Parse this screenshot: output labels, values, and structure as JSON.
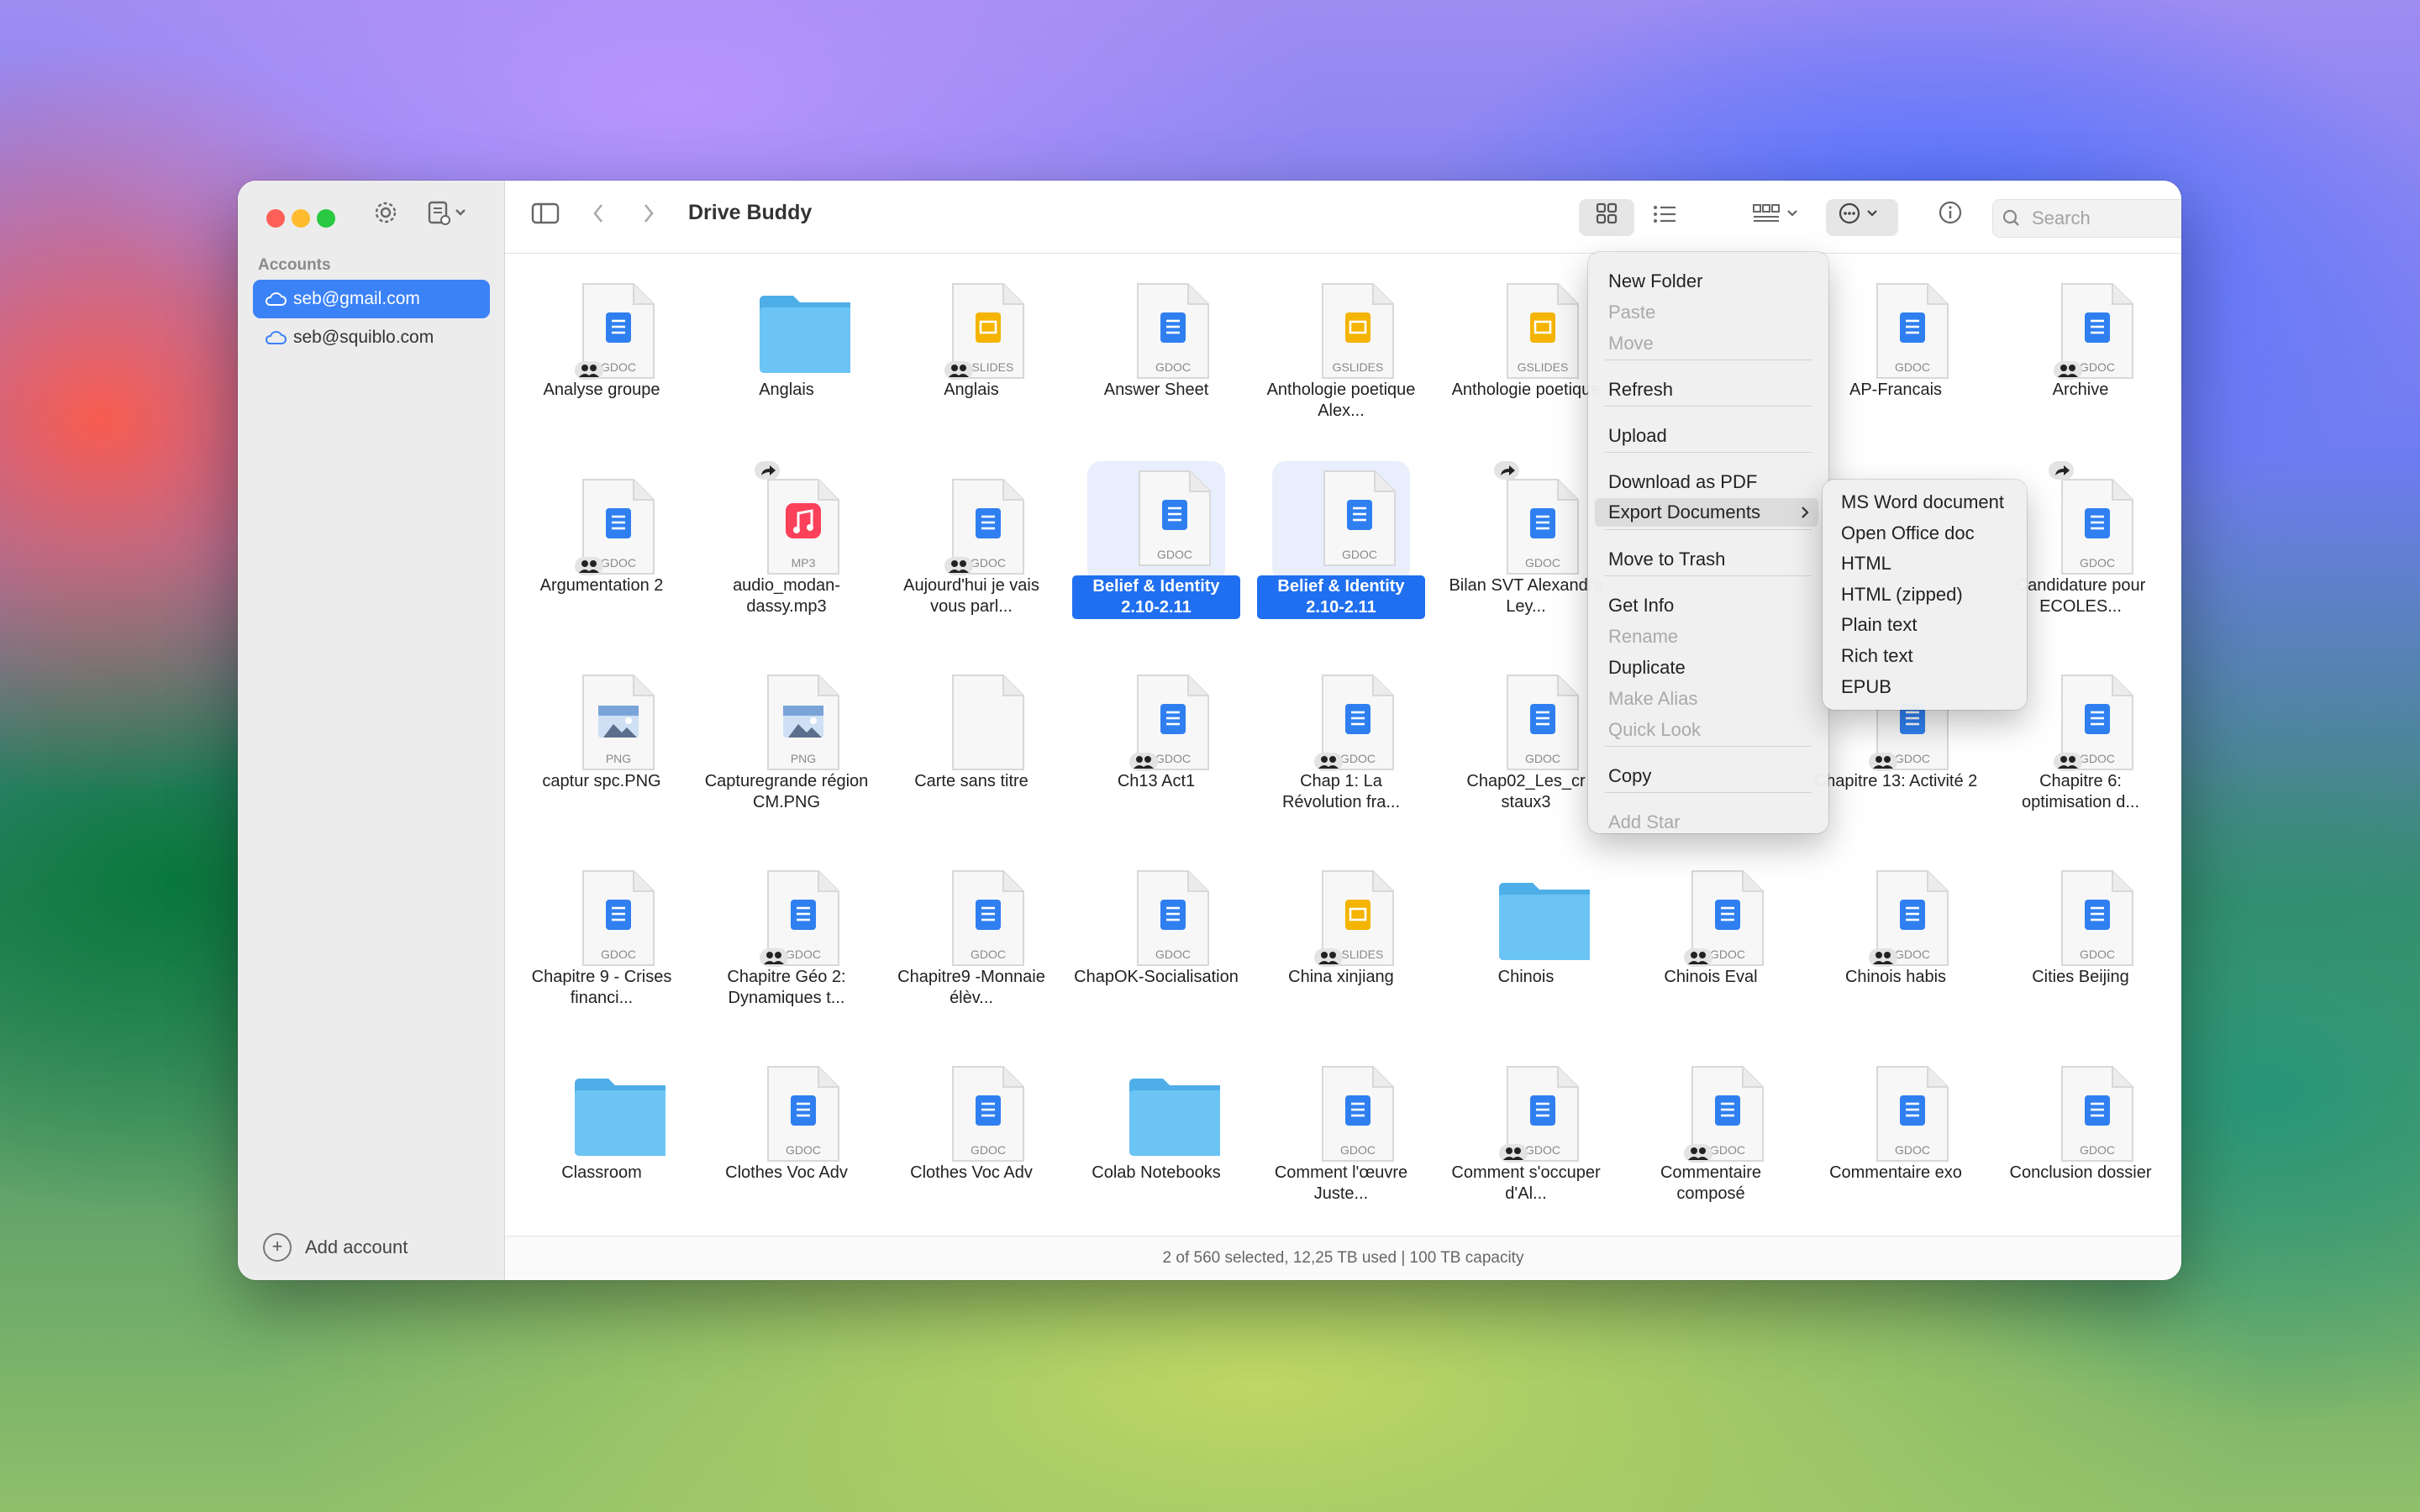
{
  "window": {
    "title": "Drive Buddy"
  },
  "sidebar": {
    "section_label": "Accounts",
    "accounts": [
      {
        "email": "seb@gmail.com",
        "selected": true
      },
      {
        "email": "seb@squiblo.com",
        "selected": false
      }
    ],
    "add_account_label": "Add account"
  },
  "search": {
    "placeholder": "Search",
    "value": ""
  },
  "files": [
    {
      "name": "Analyse groupe",
      "type": "GDOC",
      "badge": "shared"
    },
    {
      "name": "Anglais",
      "type": "FOLDER",
      "badge": ""
    },
    {
      "name": "Anglais",
      "type": "GSLIDES",
      "badge": "shared"
    },
    {
      "name": "Answer Sheet",
      "type": "GDOC",
      "badge": ""
    },
    {
      "name": "Anthologie poetique Alex...",
      "type": "GSLIDES",
      "badge": ""
    },
    {
      "name": "Anthologie poetique",
      "type": "GSLIDES",
      "badge": ""
    },
    {
      "name": "",
      "type": "HIDDEN",
      "badge": ""
    },
    {
      "name": "AP-Francais",
      "type": "GDOC",
      "badge": ""
    },
    {
      "name": "Archive",
      "type": "GDOC",
      "badge": "shared"
    },
    {
      "name": "Argumentation 2",
      "type": "GDOC",
      "badge": "shared"
    },
    {
      "name": "audio_modan-dassy.mp3",
      "type": "MP3",
      "badge": "link"
    },
    {
      "name": "Aujourd'hui je vais vous parl...",
      "type": "GDOC",
      "badge": "shared"
    },
    {
      "name": "Belief & Identity 2.10-2.11",
      "type": "GDOC",
      "badge": "",
      "selected": true
    },
    {
      "name": "Belief & Identity 2.10-2.11",
      "type": "GDOC",
      "badge": "",
      "selected": true
    },
    {
      "name": "Bilan SVT Alexandre Ley...",
      "type": "GDOC",
      "badge": "link"
    },
    {
      "name": "",
      "type": "HIDDEN",
      "badge": ""
    },
    {
      "name": "",
      "type": "HIDDEN",
      "badge": ""
    },
    {
      "name": "Candidature pour ECOLES...",
      "type": "GDOC",
      "badge": "link"
    },
    {
      "name": "captur spc.PNG",
      "type": "PNG",
      "badge": ""
    },
    {
      "name": "Capturegrande région CM.PNG",
      "type": "PNG",
      "badge": ""
    },
    {
      "name": "Carte sans titre",
      "type": "BLANK",
      "badge": ""
    },
    {
      "name": "Ch13 Act1",
      "type": "GDOC",
      "badge": "shared"
    },
    {
      "name": "Chap 1: La Révolution fra...",
      "type": "GDOC",
      "badge": "shared"
    },
    {
      "name": "Chap02_Les_cr staux3",
      "type": "GDOC",
      "badge": ""
    },
    {
      "name": "",
      "type": "HIDDEN",
      "badge": ""
    },
    {
      "name": "Chapitre 13: Activité 2",
      "type": "GDOC",
      "badge": "shared"
    },
    {
      "name": "Chapitre 6: optimisation d...",
      "type": "GDOC",
      "badge": "shared"
    },
    {
      "name": "Chapitre 9 - Crises financi...",
      "type": "GDOC",
      "badge": ""
    },
    {
      "name": "Chapitre Géo 2: Dynamiques t...",
      "type": "GDOC",
      "badge": "shared"
    },
    {
      "name": "Chapitre9 -Monnaie élèv...",
      "type": "GDOC",
      "badge": ""
    },
    {
      "name": "ChapOK-Socialisation",
      "type": "GDOC",
      "badge": ""
    },
    {
      "name": "China xinjiang",
      "type": "GSLIDES",
      "badge": "shared"
    },
    {
      "name": "Chinois",
      "type": "FOLDER",
      "badge": ""
    },
    {
      "name": "Chinois Eval",
      "type": "GDOC",
      "badge": "shared"
    },
    {
      "name": "Chinois habis",
      "type": "GDOC",
      "badge": "shared"
    },
    {
      "name": "Cities Beijing",
      "type": "GDOC",
      "badge": ""
    },
    {
      "name": "Classroom",
      "type": "FOLDER",
      "badge": ""
    },
    {
      "name": "Clothes Voc Adv",
      "type": "GDOC",
      "badge": ""
    },
    {
      "name": "Clothes Voc Adv",
      "type": "GDOC",
      "badge": ""
    },
    {
      "name": "Colab Notebooks",
      "type": "FOLDER",
      "badge": ""
    },
    {
      "name": "Comment l'œuvre Juste...",
      "type": "GDOC",
      "badge": ""
    },
    {
      "name": "Comment s'occuper d'Al...",
      "type": "GDOC",
      "badge": "shared"
    },
    {
      "name": "Commentaire composé",
      "type": "GDOC",
      "badge": "shared"
    },
    {
      "name": "Commentaire exo",
      "type": "GDOC",
      "badge": ""
    },
    {
      "name": "Conclusion dossier",
      "type": "GDOC",
      "badge": ""
    }
  ],
  "context_menu": {
    "items": [
      {
        "label": "New Folder",
        "disabled": false
      },
      {
        "label": "Paste",
        "disabled": true
      },
      {
        "label": "Move",
        "disabled": true
      },
      {
        "label": "Refresh",
        "disabled": false
      },
      {
        "label": "Upload",
        "disabled": false
      },
      {
        "label": "Download as PDF",
        "disabled": false
      },
      {
        "label": "Export Documents",
        "disabled": false,
        "submenu": true,
        "highlighted": true
      },
      {
        "label": "Move to Trash",
        "disabled": false
      },
      {
        "label": "Get Info",
        "disabled": false
      },
      {
        "label": "Rename",
        "disabled": true
      },
      {
        "label": "Duplicate",
        "disabled": false
      },
      {
        "label": "Make Alias",
        "disabled": true
      },
      {
        "label": "Quick Look",
        "disabled": true
      },
      {
        "label": "Copy",
        "disabled": false
      },
      {
        "label": "Add Star",
        "disabled": true
      }
    ]
  },
  "export_submenu": {
    "items": [
      "MS Word document",
      "Open Office doc",
      "HTML",
      "HTML (zipped)",
      "Plain text",
      "Rich text",
      "EPUB"
    ]
  },
  "status_bar": {
    "text": "2 of 560 selected, 12,25 TB used | 100 TB capacity"
  },
  "colors": {
    "accent": "#3b82f6",
    "gdoc": "#2f7ff0",
    "gslides": "#f4b400",
    "folder": "#6cc4f5",
    "mp3": "#fa4159"
  },
  "icons": {
    "sidebar_toggle": "sidebar-toggle-icon",
    "settings": "gear-icon",
    "new_doc": "new-document-icon",
    "back": "chevron-left-icon",
    "forward": "chevron-right-icon",
    "grid_view": "grid-view-icon",
    "list_view": "list-view-icon",
    "group_by": "group-by-icon",
    "more": "ellipsis-circle-icon",
    "info": "info-icon",
    "search": "search-icon",
    "profile": "person-circle-icon"
  }
}
